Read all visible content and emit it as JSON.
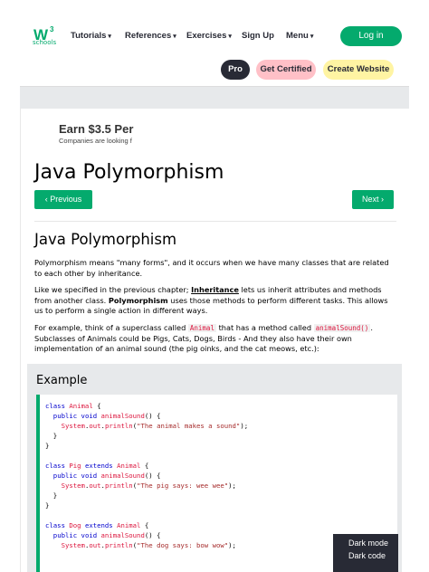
{
  "nav": {
    "logo_sub": "schools",
    "items": [
      {
        "label": "Tutorials",
        "caret": "▾"
      },
      {
        "label": "References",
        "caret": "▾"
      },
      {
        "label": "Exercises",
        "caret": "▾"
      },
      {
        "label": "Sign Up",
        "caret": ""
      },
      {
        "label": "Menu",
        "caret": "▾"
      }
    ],
    "login": "Log in",
    "pills": {
      "pro": "Pro",
      "cert": "Get Certified",
      "create": "Create Website"
    }
  },
  "ad": {
    "title": "Earn $3.5 Per",
    "sub": "Companies are looking f"
  },
  "page": {
    "title": "Java Polymorphism",
    "prev": "‹ Previous",
    "next": "Next ›",
    "heading": "Java Polymorphism",
    "p1": "Polymorphism means \"many forms\", and it occurs when we have many classes that are related to each other by inheritance.",
    "p2_a": "Like we specified in the previous chapter; ",
    "p2_link": "Inheritance",
    "p2_b": " lets us inherit attributes and methods from another class. ",
    "p2_bold": "Polymorphism",
    "p2_c": " uses those methods to perform different tasks. This allows us to perform a single action in different ways.",
    "p3_a": "For example, think of a superclass called ",
    "p3_code1": "Animal",
    "p3_b": " that has a method called ",
    "p3_code2": "animalSound()",
    "p3_c": ". Subclasses of Animals could be Pigs, Cats, Dogs, Birds - And they also have their own implementation of an animal sound (the pig oinks, and the cat meows, etc.):"
  },
  "example": {
    "title": "Example",
    "lines": [
      [
        [
          "k",
          "class "
        ],
        [
          "c",
          "Animal"
        ],
        [
          "t",
          " {"
        ]
      ],
      [
        [
          "t",
          "  "
        ],
        [
          "k",
          "public void "
        ],
        [
          "c",
          "animalSound"
        ],
        [
          "t",
          "() {"
        ]
      ],
      [
        [
          "t",
          "    "
        ],
        [
          "c",
          "System"
        ],
        [
          "t",
          "."
        ],
        [
          "c",
          "out"
        ],
        [
          "t",
          "."
        ],
        [
          "c",
          "println"
        ],
        [
          "t",
          "("
        ],
        [
          "s",
          "\"The animal makes a sound\""
        ],
        [
          "t",
          ");"
        ]
      ],
      [
        [
          "t",
          "  }"
        ]
      ],
      [
        [
          "t",
          "}"
        ]
      ],
      [
        [
          "t",
          ""
        ]
      ],
      [
        [
          "k",
          "class "
        ],
        [
          "c",
          "Pig"
        ],
        [
          "k",
          " extends "
        ],
        [
          "c",
          "Animal"
        ],
        [
          "t",
          " {"
        ]
      ],
      [
        [
          "t",
          "  "
        ],
        [
          "k",
          "public void "
        ],
        [
          "c",
          "animalSound"
        ],
        [
          "t",
          "() {"
        ]
      ],
      [
        [
          "t",
          "    "
        ],
        [
          "c",
          "System"
        ],
        [
          "t",
          "."
        ],
        [
          "c",
          "out"
        ],
        [
          "t",
          "."
        ],
        [
          "c",
          "println"
        ],
        [
          "t",
          "("
        ],
        [
          "s",
          "\"The pig says: wee wee\""
        ],
        [
          "t",
          ");"
        ]
      ],
      [
        [
          "t",
          "  }"
        ]
      ],
      [
        [
          "t",
          "}"
        ]
      ],
      [
        [
          "t",
          ""
        ]
      ],
      [
        [
          "k",
          "class "
        ],
        [
          "c",
          "Dog"
        ],
        [
          "k",
          " extends "
        ],
        [
          "c",
          "Animal"
        ],
        [
          "t",
          " {"
        ]
      ],
      [
        [
          "t",
          "  "
        ],
        [
          "k",
          "public void "
        ],
        [
          "c",
          "animalSound"
        ],
        [
          "t",
          "() {"
        ]
      ],
      [
        [
          "t",
          "    "
        ],
        [
          "c",
          "System"
        ],
        [
          "t",
          "."
        ],
        [
          "c",
          "out"
        ],
        [
          "t",
          "."
        ],
        [
          "c",
          "println"
        ],
        [
          "t",
          "("
        ],
        [
          "s",
          "\"The dog says: bow wow\""
        ],
        [
          "t",
          ");"
        ]
      ]
    ]
  },
  "darkmode": {
    "line1": "Dark mode",
    "line2": "Dark code"
  }
}
